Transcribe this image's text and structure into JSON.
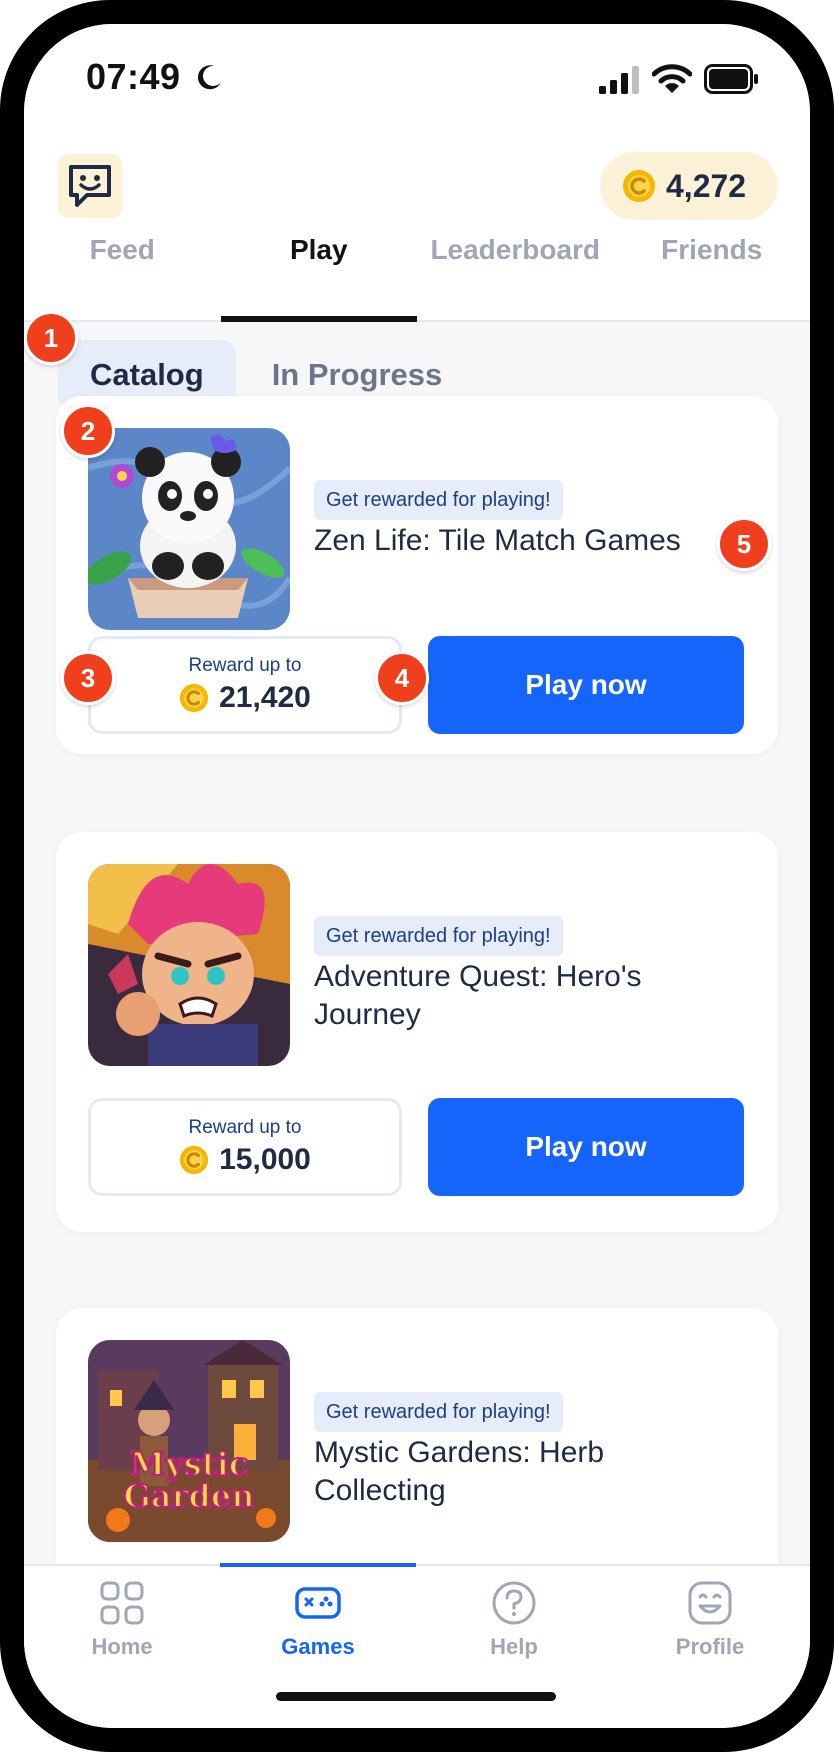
{
  "status_bar": {
    "time": "07:49"
  },
  "header": {
    "coin_balance": "4,272",
    "tabs": [
      {
        "label": "Feed",
        "active": false
      },
      {
        "label": "Play",
        "active": true
      },
      {
        "label": "Leaderboard",
        "active": false
      },
      {
        "label": "Friends",
        "active": false
      }
    ]
  },
  "segment": {
    "catalog": "Catalog",
    "in_progress": "In Progress"
  },
  "annotations": [
    "1",
    "2",
    "3",
    "4",
    "5"
  ],
  "games": [
    {
      "tag": "Get rewarded for playing!",
      "title": "Zen Life: Tile Match Games",
      "reward_label": "Reward up to",
      "reward_amount": "21,420",
      "play_label": "Play now"
    },
    {
      "tag": "Get rewarded for playing!",
      "title": "Adventure Quest: Hero's Journey",
      "reward_label": "Reward up to",
      "reward_amount": "15,000",
      "play_label": "Play now"
    },
    {
      "tag": "Get rewarded for playing!",
      "title": "Mystic Gardens: Herb Collecting",
      "thumb_text_1": "Mystic",
      "thumb_text_2": "Garden"
    }
  ],
  "bottom_nav": {
    "items": [
      {
        "label": "Home",
        "icon": "grid-icon",
        "active": false
      },
      {
        "label": "Games",
        "icon": "gamepad-icon",
        "active": true
      },
      {
        "label": "Help",
        "icon": "help-icon",
        "active": false
      },
      {
        "label": "Profile",
        "icon": "profile-icon",
        "active": false
      }
    ]
  },
  "colors": {
    "accent": "#1565fa",
    "badge": "#ef3f1d",
    "coin": "#f5b800",
    "tag_bg": "#e6ecfa",
    "coin_pill_bg": "#fdf2d8"
  }
}
